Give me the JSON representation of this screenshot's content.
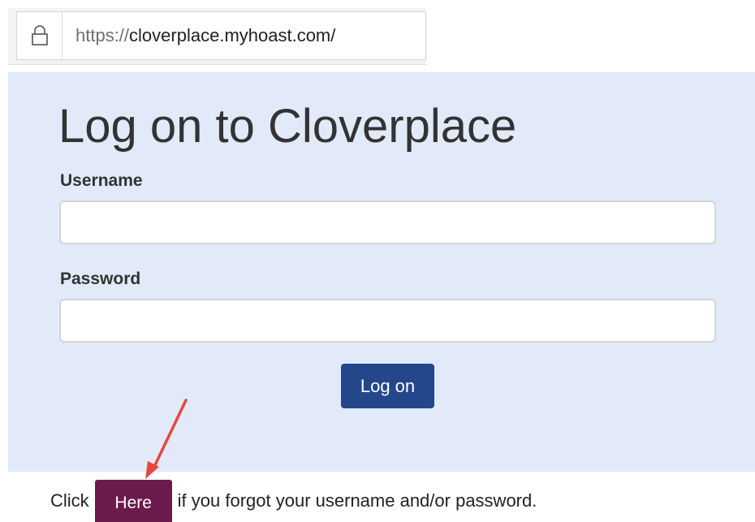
{
  "address_bar": {
    "icon": "lock-icon",
    "scheme": "https://",
    "host_path": "cloverplace.myhoast.com/"
  },
  "login": {
    "title": "Log on to Cloverplace",
    "username_label": "Username",
    "username_value": "",
    "password_label": "Password",
    "password_value": "",
    "submit_label": "Log on"
  },
  "forgot": {
    "prefix": "Click",
    "link_label": "Here",
    "suffix": "if you forgot your username and/or password."
  },
  "colors": {
    "panel_background": "#e2eaf9",
    "button_background": "#24478c",
    "here_background": "#6b1a4b",
    "annotation_arrow": "#e8463f"
  }
}
